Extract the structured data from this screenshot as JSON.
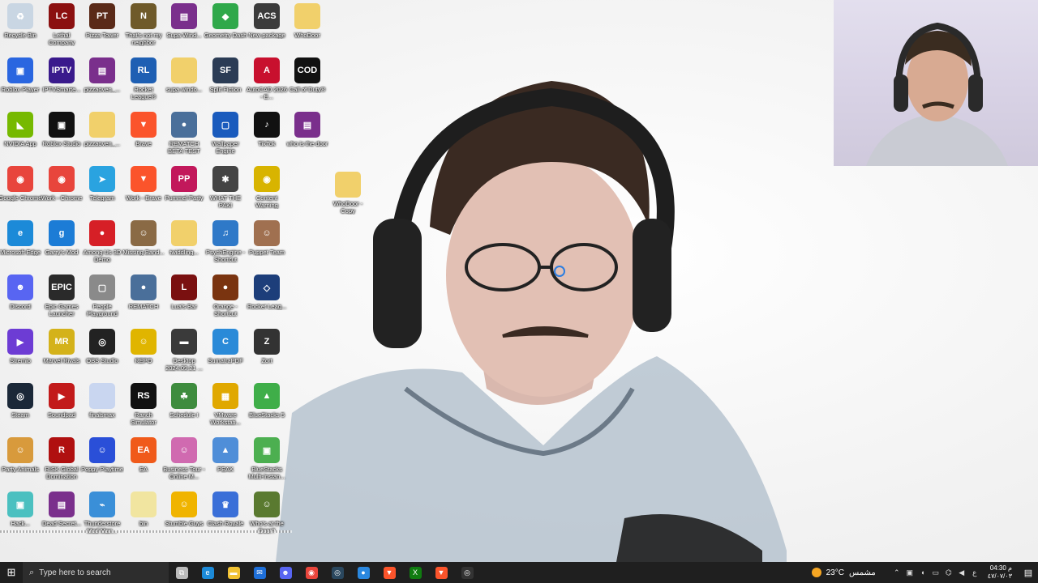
{
  "desktop": {
    "icons": [
      {
        "label": "Recycle Bin",
        "glyph": "♻",
        "color": "#c9d6e3",
        "icon": "recycle-bin-icon"
      },
      {
        "label": "Lethal Company",
        "glyph": "LC",
        "color": "#8b1010",
        "icon": "lethal-company-icon"
      },
      {
        "label": "Pizza Tower",
        "glyph": "PT",
        "color": "#5a2a18",
        "icon": "pizza-tower-icon"
      },
      {
        "label": "That's not my neighbor",
        "glyph": "N",
        "color": "#6f5a2a",
        "icon": "neighbor-game-icon"
      },
      {
        "label": "Supa Wind...",
        "glyph": "▤",
        "color": "#7a2f8c",
        "icon": "winrar-icon"
      },
      {
        "label": "Geometry Dash",
        "glyph": "◆",
        "color": "#2fa84a",
        "icon": "geometry-dash-icon"
      },
      {
        "label": "New package",
        "glyph": "ACS",
        "color": "#3b3b3b",
        "icon": "package-icon"
      },
      {
        "label": "WhoDoor",
        "glyph": "",
        "color": "#f1d06b",
        "icon": "folder-icon"
      },
      {
        "label": "Roblox Player",
        "glyph": "▣",
        "color": "#2a66e0",
        "icon": "roblox-player-icon"
      },
      {
        "label": "IPTVSmarte...",
        "glyph": "IPTV",
        "color": "#3a1a8c",
        "icon": "iptv-icon"
      },
      {
        "label": "pizzaoven_...",
        "glyph": "▤",
        "color": "#7a2f8c",
        "icon": "winrar-icon"
      },
      {
        "label": "Rocket League®",
        "glyph": "RL",
        "color": "#1e5fb3",
        "icon": "rocket-league-icon"
      },
      {
        "label": "supa windo...",
        "glyph": "",
        "color": "#f1d06b",
        "icon": "folder-icon"
      },
      {
        "label": "Split Fiction",
        "glyph": "SF",
        "color": "#2b3c55",
        "icon": "split-fiction-icon"
      },
      {
        "label": "AutoCAD 2026 - E...",
        "glyph": "A",
        "color": "#c8102e",
        "icon": "autocad-icon"
      },
      {
        "label": "Call of Duty®",
        "glyph": "COD",
        "color": "#111111",
        "icon": "call-of-duty-icon"
      },
      {
        "label": "NVIDIA App",
        "glyph": "◣",
        "color": "#76b900",
        "icon": "nvidia-icon"
      },
      {
        "label": "Roblox Studio",
        "glyph": "▣",
        "color": "#111111",
        "icon": "roblox-studio-icon"
      },
      {
        "label": "pizzaoven_...",
        "glyph": "",
        "color": "#f1d06b",
        "icon": "folder-icon"
      },
      {
        "label": "Brave",
        "glyph": "▼",
        "color": "#fb542b",
        "icon": "brave-icon"
      },
      {
        "label": "REMATCH BETA TEST",
        "glyph": "●",
        "color": "#4a6f9a",
        "icon": "rematch-icon"
      },
      {
        "label": "Wallpaper Engine",
        "glyph": "▢",
        "color": "#1a5bbd",
        "icon": "wallpaper-engine-icon"
      },
      {
        "label": "TikTok",
        "glyph": "♪",
        "color": "#111111",
        "icon": "tiktok-icon"
      },
      {
        "label": "who is the door",
        "glyph": "▤",
        "color": "#7a2f8c",
        "icon": "winrar-icon"
      },
      {
        "label": "Google Chrome",
        "glyph": "◉",
        "color": "#e8453c",
        "icon": "chrome-icon"
      },
      {
        "label": "Work - Chrome",
        "glyph": "◉",
        "color": "#e8453c",
        "icon": "chrome-icon"
      },
      {
        "label": "Telegram",
        "glyph": "➤",
        "color": "#2aa3e0",
        "icon": "telegram-icon"
      },
      {
        "label": "Work - Brave",
        "glyph": "▼",
        "color": "#fb542b",
        "icon": "brave-icon"
      },
      {
        "label": "Pummel Party",
        "glyph": "PP",
        "color": "#c2185b",
        "icon": "pummel-party-icon"
      },
      {
        "label": "WHAT THE PAKI",
        "glyph": "✱",
        "color": "#444444",
        "icon": "game-icon"
      },
      {
        "label": "Content Warning",
        "glyph": "◉",
        "color": "#d8b400",
        "icon": "content-warning-icon"
      },
      {
        "label": "Microsoft Edge",
        "glyph": "e",
        "color": "#1c8ad8",
        "icon": "edge-icon"
      },
      {
        "label": "Garry's Mod",
        "glyph": "g",
        "color": "#1c7cd6",
        "icon": "garrys-mod-icon"
      },
      {
        "label": "Among Us 3D Demo",
        "glyph": "●",
        "color": "#d61f26",
        "icon": "among-us-icon"
      },
      {
        "label": "Missing Band...",
        "glyph": "☺",
        "color": "#8a6a45",
        "icon": "game-icon"
      },
      {
        "label": "twiddling...",
        "glyph": "",
        "color": "#f1d06b",
        "icon": "file-icon"
      },
      {
        "label": "PsychEngine - Shortcut",
        "glyph": "♫",
        "color": "#2f79c8",
        "icon": "psych-engine-icon"
      },
      {
        "label": "Puppet Team",
        "glyph": "☺",
        "color": "#a07050",
        "icon": "game-icon"
      },
      {
        "label": "Discord",
        "glyph": "☻",
        "color": "#5865f2",
        "icon": "discord-icon"
      },
      {
        "label": "Epic Games Launcher",
        "glyph": "EPIC",
        "color": "#2a2a2a",
        "icon": "epic-games-icon"
      },
      {
        "label": "People Playground",
        "glyph": "▢",
        "color": "#8a8a8a",
        "icon": "people-playground-icon"
      },
      {
        "label": "REMATCH",
        "glyph": "●",
        "color": "#4a6f9a",
        "icon": "rematch-icon"
      },
      {
        "label": "Lua's Bar",
        "glyph": "L",
        "color": "#7a1010",
        "icon": "game-icon"
      },
      {
        "label": "Orange - Shortcut",
        "glyph": "●",
        "color": "#7a3410",
        "icon": "game-icon"
      },
      {
        "label": "Rocket Leag...",
        "glyph": "◇",
        "color": "#1d3e7a",
        "icon": "rocket-league-icon"
      },
      {
        "label": "Stremio",
        "glyph": "▶",
        "color": "#6d3cd4",
        "icon": "stremio-icon"
      },
      {
        "label": "Marvel Rivals",
        "glyph": "MR",
        "color": "#d4b21a",
        "icon": "marvel-rivals-icon"
      },
      {
        "label": "OBS Studio",
        "glyph": "◎",
        "color": "#222222",
        "icon": "obs-icon"
      },
      {
        "label": "REPO",
        "glyph": "☺",
        "color": "#e0b500",
        "icon": "repo-icon"
      },
      {
        "label": "Desktop 2024.09.21 ...",
        "glyph": "▬",
        "color": "#3a3a3a",
        "icon": "video-file-icon"
      },
      {
        "label": "SumatraPDF",
        "glyph": "C",
        "color": "#2a8ad8",
        "icon": "pdf-icon"
      },
      {
        "label": "Zort",
        "glyph": "Z",
        "color": "#333333",
        "icon": "game-icon"
      },
      {
        "label": "Steam",
        "glyph": "◎",
        "color": "#1b2838",
        "icon": "steam-icon"
      },
      {
        "label": "Soundpad",
        "glyph": "▶",
        "color": "#c21a1a",
        "icon": "soundpad-icon"
      },
      {
        "label": "finalsmax",
        "glyph": "",
        "color": "#c9d6f0",
        "icon": "file-icon"
      },
      {
        "label": "Ranch Simulator",
        "glyph": "RS",
        "color": "#111111",
        "icon": "ranch-simulator-icon"
      },
      {
        "label": "Schedule I",
        "glyph": "☘",
        "color": "#3e8c3e",
        "icon": "schedule-icon"
      },
      {
        "label": "VMware Workstati...",
        "glyph": "▦",
        "color": "#e0a800",
        "icon": "vmware-icon"
      },
      {
        "label": "BlueStacks 5",
        "glyph": "▲",
        "color": "#3fae49",
        "icon": "bluestacks-icon"
      },
      {
        "label": "Party Animals",
        "glyph": "☺",
        "color": "#d89a3c",
        "icon": "party-animals-icon"
      },
      {
        "label": "RISK Global Domination",
        "glyph": "R",
        "color": "#b01010",
        "icon": "risk-icon"
      },
      {
        "label": "Poppy Playtime",
        "glyph": "☺",
        "color": "#2a4fd8",
        "icon": "poppy-playtime-icon"
      },
      {
        "label": "EA",
        "glyph": "EA",
        "color": "#f05a1a",
        "icon": "ea-icon"
      },
      {
        "label": "Business Tour - Online M...",
        "glyph": "☺",
        "color": "#d06ab0",
        "icon": "game-icon"
      },
      {
        "label": "PEAK",
        "glyph": "▲",
        "color": "#4f8ed8",
        "icon": "peak-icon"
      },
      {
        "label": "BlueStacks Multi-Instan...",
        "glyph": "▣",
        "color": "#4caf50",
        "icon": "bluestacks-icon"
      },
      {
        "label": "Hack...",
        "glyph": "▣",
        "color": "#4bc0c0",
        "icon": "app-icon"
      },
      {
        "label": "Dead Secret...",
        "glyph": "▤",
        "color": "#7a2f8c",
        "icon": "winrar-icon"
      },
      {
        "label": "Thunderstore Mod Man...",
        "glyph": "⌁",
        "color": "#3a8fd8",
        "icon": "thunderstore-icon"
      },
      {
        "label": "bin",
        "glyph": "",
        "color": "#f1e5a0",
        "icon": "file-icon"
      },
      {
        "label": "Stumble Guys",
        "glyph": "☺",
        "color": "#f0b400",
        "icon": "stumble-guys-icon"
      },
      {
        "label": "Clash Royale",
        "glyph": "♛",
        "color": "#3a6fd8",
        "icon": "clash-royale-icon"
      },
      {
        "label": "Who's at the Door?",
        "glyph": "☺",
        "color": "#5a7a30",
        "icon": "game-icon"
      }
    ],
    "extra_icon": {
      "label": "WhoDoor - Copy",
      "icon": "folder-icon",
      "color": "#f1d06b"
    }
  },
  "taskbar": {
    "search_placeholder": "Type here to search",
    "pinned": [
      {
        "name": "task-view",
        "color": "#bbbbbb",
        "glyph": "⧉"
      },
      {
        "name": "edge",
        "color": "#1c8ad8",
        "glyph": "e"
      },
      {
        "name": "file-explorer",
        "color": "#f1c232",
        "glyph": "▬"
      },
      {
        "name": "outlook",
        "color": "#1e6fd8",
        "glyph": "✉"
      },
      {
        "name": "discord",
        "color": "#5865f2",
        "glyph": "☻"
      },
      {
        "name": "chrome",
        "color": "#e8453c",
        "glyph": "◉"
      },
      {
        "name": "steam",
        "color": "#2a475e",
        "glyph": "◎"
      },
      {
        "name": "app",
        "color": "#2a88e0",
        "glyph": "●"
      },
      {
        "name": "brave",
        "color": "#fb542b",
        "glyph": "▼"
      },
      {
        "name": "xbox",
        "color": "#107c10",
        "glyph": "X"
      },
      {
        "name": "brave-work",
        "color": "#fb542b",
        "glyph": "▼"
      },
      {
        "name": "obs",
        "color": "#333333",
        "glyph": "◎"
      }
    ],
    "weather_temp": "23°C",
    "weather_desc": "مشمس",
    "lang": "ع",
    "time": "04:30 م",
    "date": "٤٧/٠٧/٠٣"
  }
}
